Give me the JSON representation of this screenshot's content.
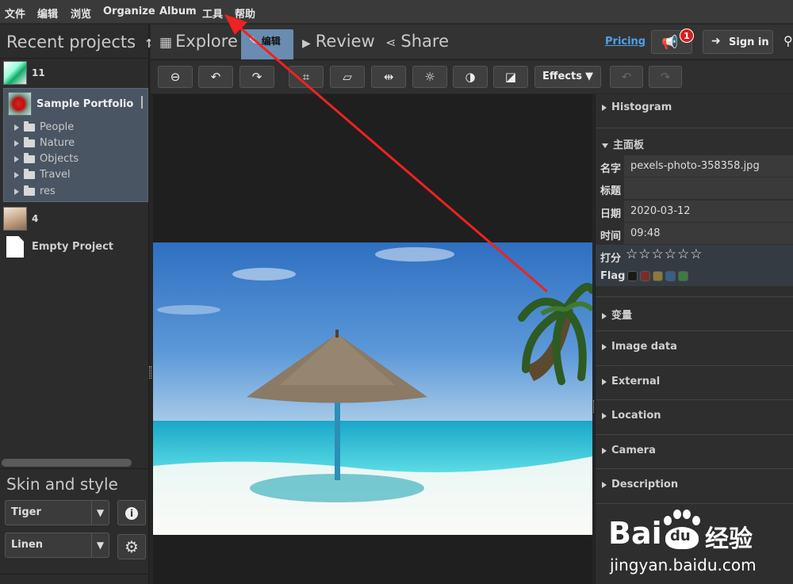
{
  "menubar": {
    "items": [
      "文件",
      "编辑",
      "浏览",
      "Organize",
      "Album",
      "工具",
      "帮助"
    ]
  },
  "left": {
    "recent_title": "Recent projects",
    "projects": [
      {
        "label": "11"
      },
      {
        "label": "Sample Portfolio"
      },
      {
        "label": "4"
      },
      {
        "label": "Empty Project"
      }
    ],
    "folders": [
      "People",
      "Nature",
      "Objects",
      "Travel",
      "res"
    ],
    "skin_title": "Skin and style",
    "skin_value": "Tiger",
    "style_value": "Linen"
  },
  "top": {
    "tabs": {
      "explore": "Explore",
      "edit": "编辑",
      "review": "Review",
      "share": "Share"
    },
    "pricing": "Pricing",
    "notif_count": "1",
    "signin": "Sign in"
  },
  "toolbar": {
    "effects": "Effects"
  },
  "right": {
    "histogram": "Histogram",
    "main_panel": "主面板",
    "props": {
      "name_key": "名字",
      "name_val": "pexels-photo-358358.jpg",
      "title_key": "标题",
      "title_val": "",
      "date_key": "日期",
      "date_val": "2020-03-12",
      "time_key": "时间",
      "time_val": "09:48",
      "rating_key": "打分",
      "rating": 0,
      "rating_max": 6,
      "flag_key": "Flag"
    },
    "flag_colors": [
      "#1a1a1a",
      "#7a2d2d",
      "#8a7a3a",
      "#35608a",
      "#3e7a3e"
    ],
    "sections": [
      "变量",
      "Image data",
      "External",
      "Location",
      "Camera",
      "Description"
    ]
  },
  "watermark": {
    "brand": "Bai",
    "brand2": "du",
    "brand_cn": "经验",
    "url": "jingyan.baidu.com"
  }
}
